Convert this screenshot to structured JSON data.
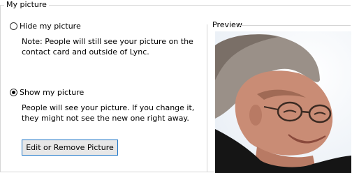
{
  "group": {
    "title": "My picture"
  },
  "options": {
    "hide": {
      "label": "Hide my picture",
      "checked": false,
      "note": "Note: People will still see your picture on the contact card and outside of Lync."
    },
    "show": {
      "label": "Show my picture",
      "checked": true,
      "note": "People will see your picture. If you change it, they might not see the new one right away."
    }
  },
  "button": {
    "label": "Edit or Remove Picture"
  },
  "preview": {
    "label": "Preview"
  }
}
